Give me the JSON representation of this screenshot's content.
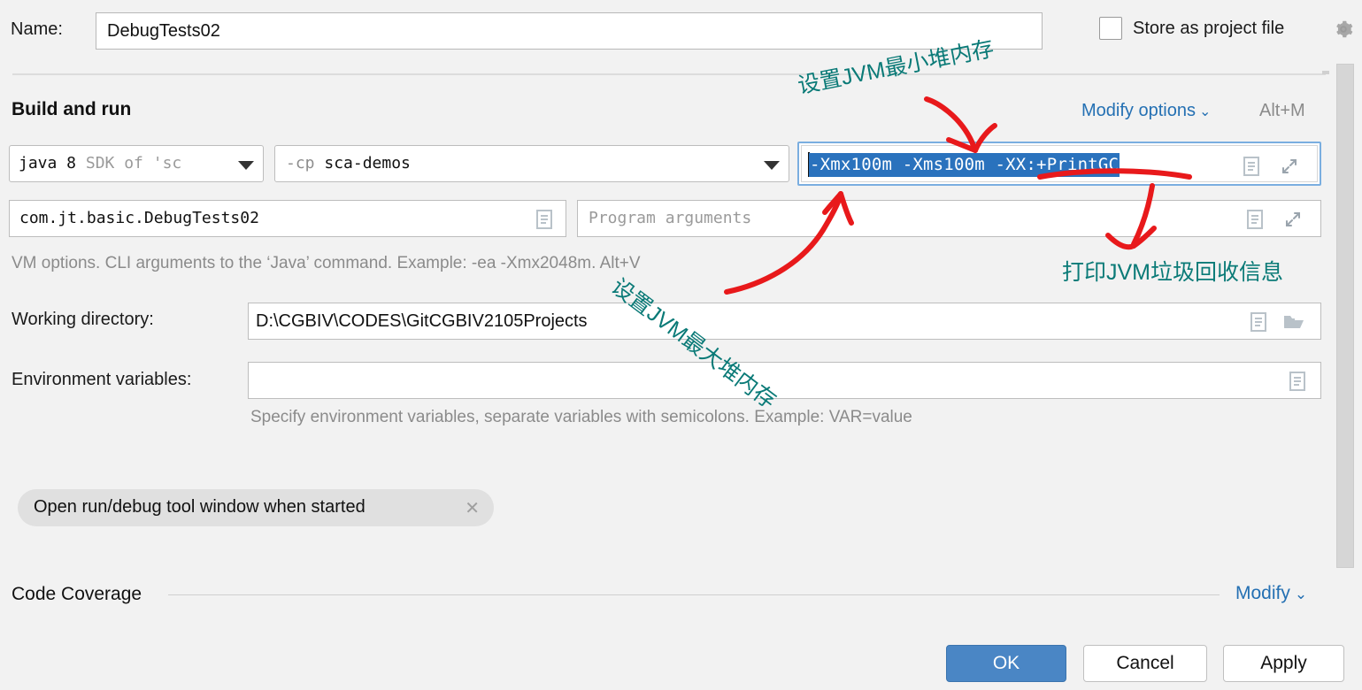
{
  "dialog": {
    "name_label": "Name:",
    "name_value": "DebugTests02",
    "store_as_project_file": "Store as project file",
    "gear_icon": "gear-icon"
  },
  "build_and_run": {
    "title": "Build and run",
    "modify_options": "Modify options",
    "modify_options_shortcut": "Alt+M",
    "jdk": {
      "value_bold": "java 8",
      "value_dim": " SDK of 'sc",
      "dropdown_icon": "chevron-down-icon"
    },
    "classpath": {
      "prefix": "-cp",
      "value": " sca-demos",
      "dropdown_icon": "chevron-down-icon"
    },
    "vm_options": {
      "value": "-Xmx100m -Xms100m -XX:+PrintGC",
      "selected": true,
      "selection_color": "#2a72bd",
      "focus_border_color": "#7aaee0",
      "doc_icon": "document-icon",
      "expand_icon": "expand-icon"
    },
    "main_class": {
      "value": "com.jt.basic.DebugTests02",
      "doc_icon": "document-icon"
    },
    "program_arguments": {
      "placeholder": "Program arguments",
      "doc_icon": "document-icon",
      "expand_icon": "expand-icon"
    },
    "vm_hint": "VM options. CLI arguments to the ‘Java’ command. Example: -ea -Xmx2048m. Alt+V"
  },
  "working_directory": {
    "label": "Working directory:",
    "value": "D:\\CGBIV\\CODES\\GitCGBIV2105Projects",
    "doc_icon": "document-icon",
    "folder_icon": "folder-icon"
  },
  "environment_variables": {
    "label": "Environment variables:",
    "value": "",
    "hint": "Specify environment variables, separate variables with semicolons. Example: VAR=value",
    "doc_icon": "document-icon"
  },
  "chip": {
    "label": "Open run/debug tool window when started",
    "close_icon": "close-icon"
  },
  "code_coverage": {
    "title": "Code Coverage",
    "modify": "Modify",
    "chevron_icon": "chevron-down-icon"
  },
  "buttons": {
    "ok": "OK",
    "cancel": "Cancel",
    "apply": "Apply"
  },
  "annotations": {
    "min_heap": "设置JVM最小堆内存",
    "max_heap": "设置JVM最大堆内存",
    "print_gc": "打印JVM垃圾回收信息",
    "ink_color": "#0a7a77",
    "arrow_color": "#e8191b"
  },
  "colors": {
    "accent_blue": "#2470b3",
    "ok_button": "#4a86c5",
    "background": "#f2f2f2"
  }
}
